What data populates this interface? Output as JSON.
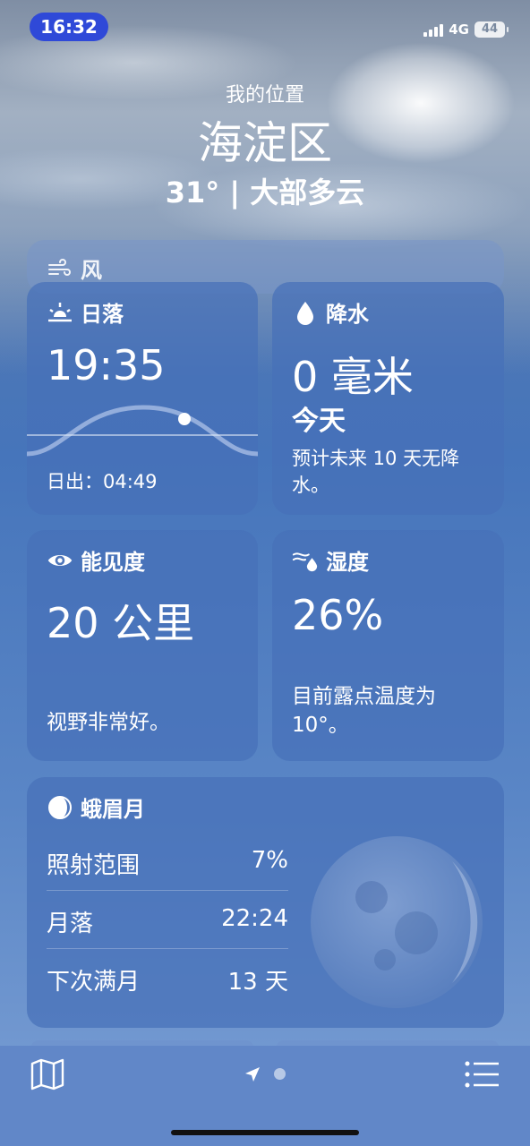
{
  "status_bar": {
    "time": "16:32",
    "network": "4G",
    "battery": "44"
  },
  "header": {
    "location_label": "我的位置",
    "city": "海淀区",
    "summary": "31° | 大部多云"
  },
  "wind": {
    "title": "风"
  },
  "sunset": {
    "title": "日落",
    "time": "19:35",
    "sunrise": "日出：04:49"
  },
  "precipitation": {
    "title": "降水",
    "value": "0 毫米",
    "period": "今天",
    "note": "预计未来 10 天无降水。"
  },
  "visibility": {
    "title": "能见度",
    "value": "20 公里",
    "note": "视野非常好。"
  },
  "humidity": {
    "title": "湿度",
    "value": "26%",
    "note": "目前露点温度为 10°。"
  },
  "moon": {
    "title": "蛾眉月",
    "rows": [
      {
        "label": "照射范围",
        "value": "7%"
      },
      {
        "label": "月落",
        "value": "22:24"
      },
      {
        "label": "下次满月",
        "value": "13 天"
      }
    ]
  },
  "tabbar": {
    "icons": [
      "map-icon",
      "location-arrow-icon",
      "list-icon"
    ]
  }
}
